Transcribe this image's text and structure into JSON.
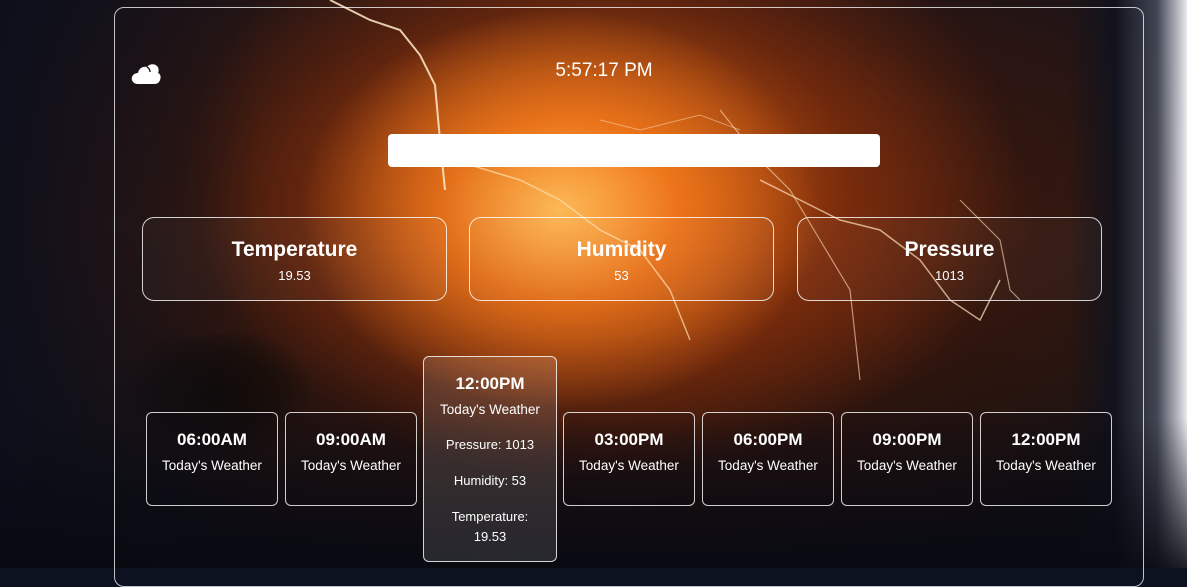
{
  "header": {
    "logo_icon": "cloud-icon",
    "clock": "5:57:17 PM"
  },
  "search": {
    "value": "",
    "placeholder": ""
  },
  "stats": [
    {
      "label": "Temperature",
      "value": "19.53"
    },
    {
      "label": "Humidity",
      "value": "53"
    },
    {
      "label": "Pressure",
      "value": "1013"
    }
  ],
  "forecast": [
    {
      "time": "06:00AM",
      "subtitle": "Today's Weather"
    },
    {
      "time": "09:00AM",
      "subtitle": "Today's Weather"
    },
    {
      "time": "12:00PM",
      "subtitle": "Today's Weather",
      "pressure": "Pressure: 1013",
      "humidity": "Humidity: 53",
      "temperature_label": "Temperature:",
      "temperature_value": "19.53"
    },
    {
      "time": "03:00PM",
      "subtitle": "Today's Weather"
    },
    {
      "time": "06:00PM",
      "subtitle": "Today's Weather"
    },
    {
      "time": "09:00PM",
      "subtitle": "Today's Weather"
    },
    {
      "time": "12:00PM",
      "subtitle": "Today's Weather"
    }
  ]
}
